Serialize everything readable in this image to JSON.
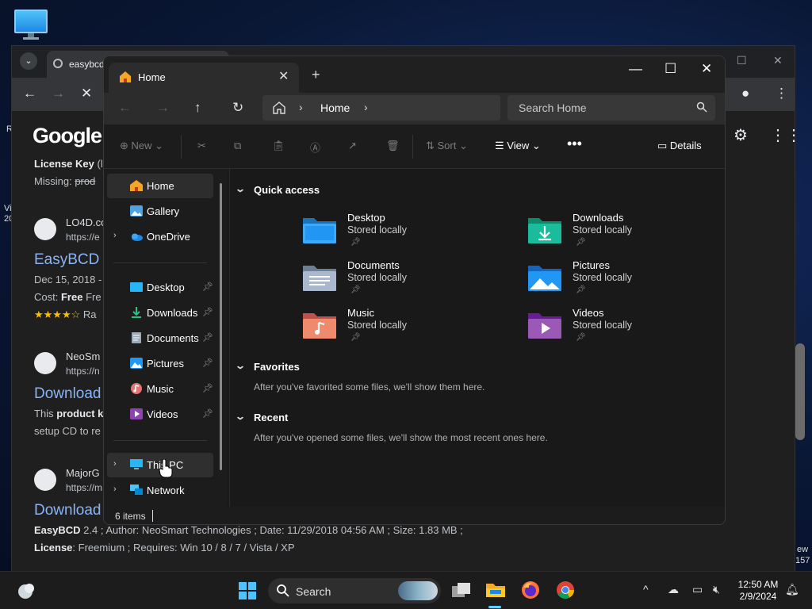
{
  "desktop": {
    "edge_text": [
      "R",
      "Vi",
      "20",
      "ew",
      "157"
    ]
  },
  "chrome": {
    "tab_title": "easybcd",
    "results": {
      "license_key_label": "License Key",
      "license_key_suffix": "(l",
      "missing_label": "Missing:",
      "missing_value": "prod",
      "r1_site": "LO4D.co",
      "r1_url": "https://e",
      "r1_title": "EasyBCD",
      "r1_date": "Dec 15, 2018 -",
      "r1_cost_label": "Cost:",
      "r1_cost_value": "Free",
      "r1_cost_rest": "Fre",
      "r1_stars": "★★★★☆",
      "r1_rating": "Ra",
      "r2_site": "NeoSm",
      "r2_url": "https://n",
      "r2_title": "Download",
      "r2_snippet1_a": "This",
      "r2_snippet1_b": "product k",
      "r2_snippet2": "setup CD to re",
      "r3_site": "MajorG",
      "r3_url": "https://m",
      "r3_title": "Download",
      "r3_line1_bold": "EasyBCD",
      "r3_line1_rest": "2.4 ; Author: NeoSmart Technologies ; Date: 11/29/2018 04:56 AM ; Size: 1.83 MB ;",
      "r3_line2_bold": "License",
      "r3_line2_rest": ": Freemium ; Requires: Win 10 / 8 / 7 / Vista / XP"
    },
    "google_logo": "Google"
  },
  "explorer": {
    "tab_title": "Home",
    "address": {
      "crumb": "Home"
    },
    "search_placeholder": "Search Home",
    "commands": {
      "new": "New",
      "sort": "Sort",
      "view": "View",
      "details": "Details"
    },
    "sidebar": {
      "items": [
        {
          "label": "Home"
        },
        {
          "label": "Gallery"
        },
        {
          "label": "OneDrive"
        },
        {
          "label": "Desktop"
        },
        {
          "label": "Downloads"
        },
        {
          "label": "Documents"
        },
        {
          "label": "Pictures"
        },
        {
          "label": "Music"
        },
        {
          "label": "Videos"
        },
        {
          "label": "This PC"
        },
        {
          "label": "Network"
        }
      ]
    },
    "sections": {
      "quick_access": "Quick access",
      "favorites": "Favorites",
      "favorites_note": "After you've favorited some files, we'll show them here.",
      "recent": "Recent",
      "recent_note": "After you've opened some files, we'll show the most recent ones here."
    },
    "quick_access": [
      {
        "name": "Desktop",
        "status": "Stored locally"
      },
      {
        "name": "Downloads",
        "status": "Stored locally"
      },
      {
        "name": "Documents",
        "status": "Stored locally"
      },
      {
        "name": "Pictures",
        "status": "Stored locally"
      },
      {
        "name": "Music",
        "status": "Stored locally"
      },
      {
        "name": "Videos",
        "status": "Stored locally"
      }
    ],
    "status": "6 items"
  },
  "taskbar": {
    "search_label": "Search",
    "time": "12:50 AM",
    "date": "2/9/2024"
  },
  "colors": {
    "accent": "#60cdff",
    "link": "#8ab4f8",
    "explorer_bg": "#191919"
  }
}
